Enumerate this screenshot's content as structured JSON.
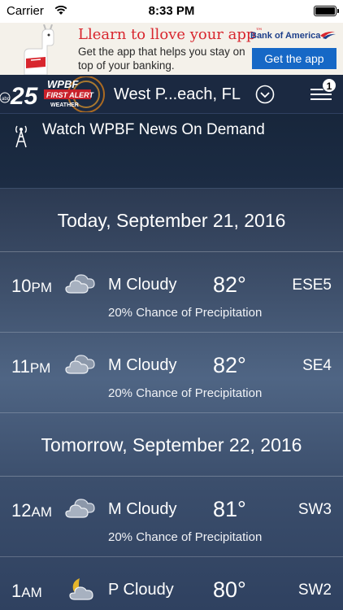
{
  "status_bar": {
    "carrier": "Carrier",
    "time": "8:33 PM"
  },
  "ad": {
    "headline": "Llearn to llove your app",
    "trademark": "™",
    "body": "Get the app that helps you stay on top of your banking.",
    "bank_name": "Bank of America",
    "cta": "Get the app"
  },
  "header": {
    "logo_number": "25",
    "logo_station": "WPBF",
    "logo_sub": "FIRST ALERT",
    "logo_weather": "WEATHER",
    "logo_network": "abc",
    "location": "West P...each, FL",
    "menu_badge": "1"
  },
  "news": {
    "label": "Watch WPBF News On Demand"
  },
  "forecast": {
    "days": [
      {
        "title": "Today, September 21, 2016"
      },
      {
        "title": "Tomorrow, September 22, 2016"
      }
    ],
    "hours": [
      {
        "hour": "10",
        "ampm": "PM",
        "icon": "cloudy-icon",
        "condition": "M Cloudy",
        "temp": "82°",
        "wind": "ESE5",
        "precip": "20% Chance of Precipitation"
      },
      {
        "hour": "11",
        "ampm": "PM",
        "icon": "cloudy-icon",
        "condition": "M Cloudy",
        "temp": "82°",
        "wind": "SE4",
        "precip": "20% Chance of Precipitation"
      },
      {
        "hour": "12",
        "ampm": "AM",
        "icon": "cloudy-icon",
        "condition": "M Cloudy",
        "temp": "81°",
        "wind": "SW3",
        "precip": "20% Chance of Precipitation"
      },
      {
        "hour": "1",
        "ampm": "AM",
        "icon": "moon-cloud-icon",
        "condition": "P Cloudy",
        "temp": "80°",
        "wind": "SW2",
        "precip": ""
      }
    ]
  },
  "colors": {
    "background": "#1c2a3f",
    "ad_accent": "#d8262e",
    "cta_blue": "#1668c6"
  }
}
